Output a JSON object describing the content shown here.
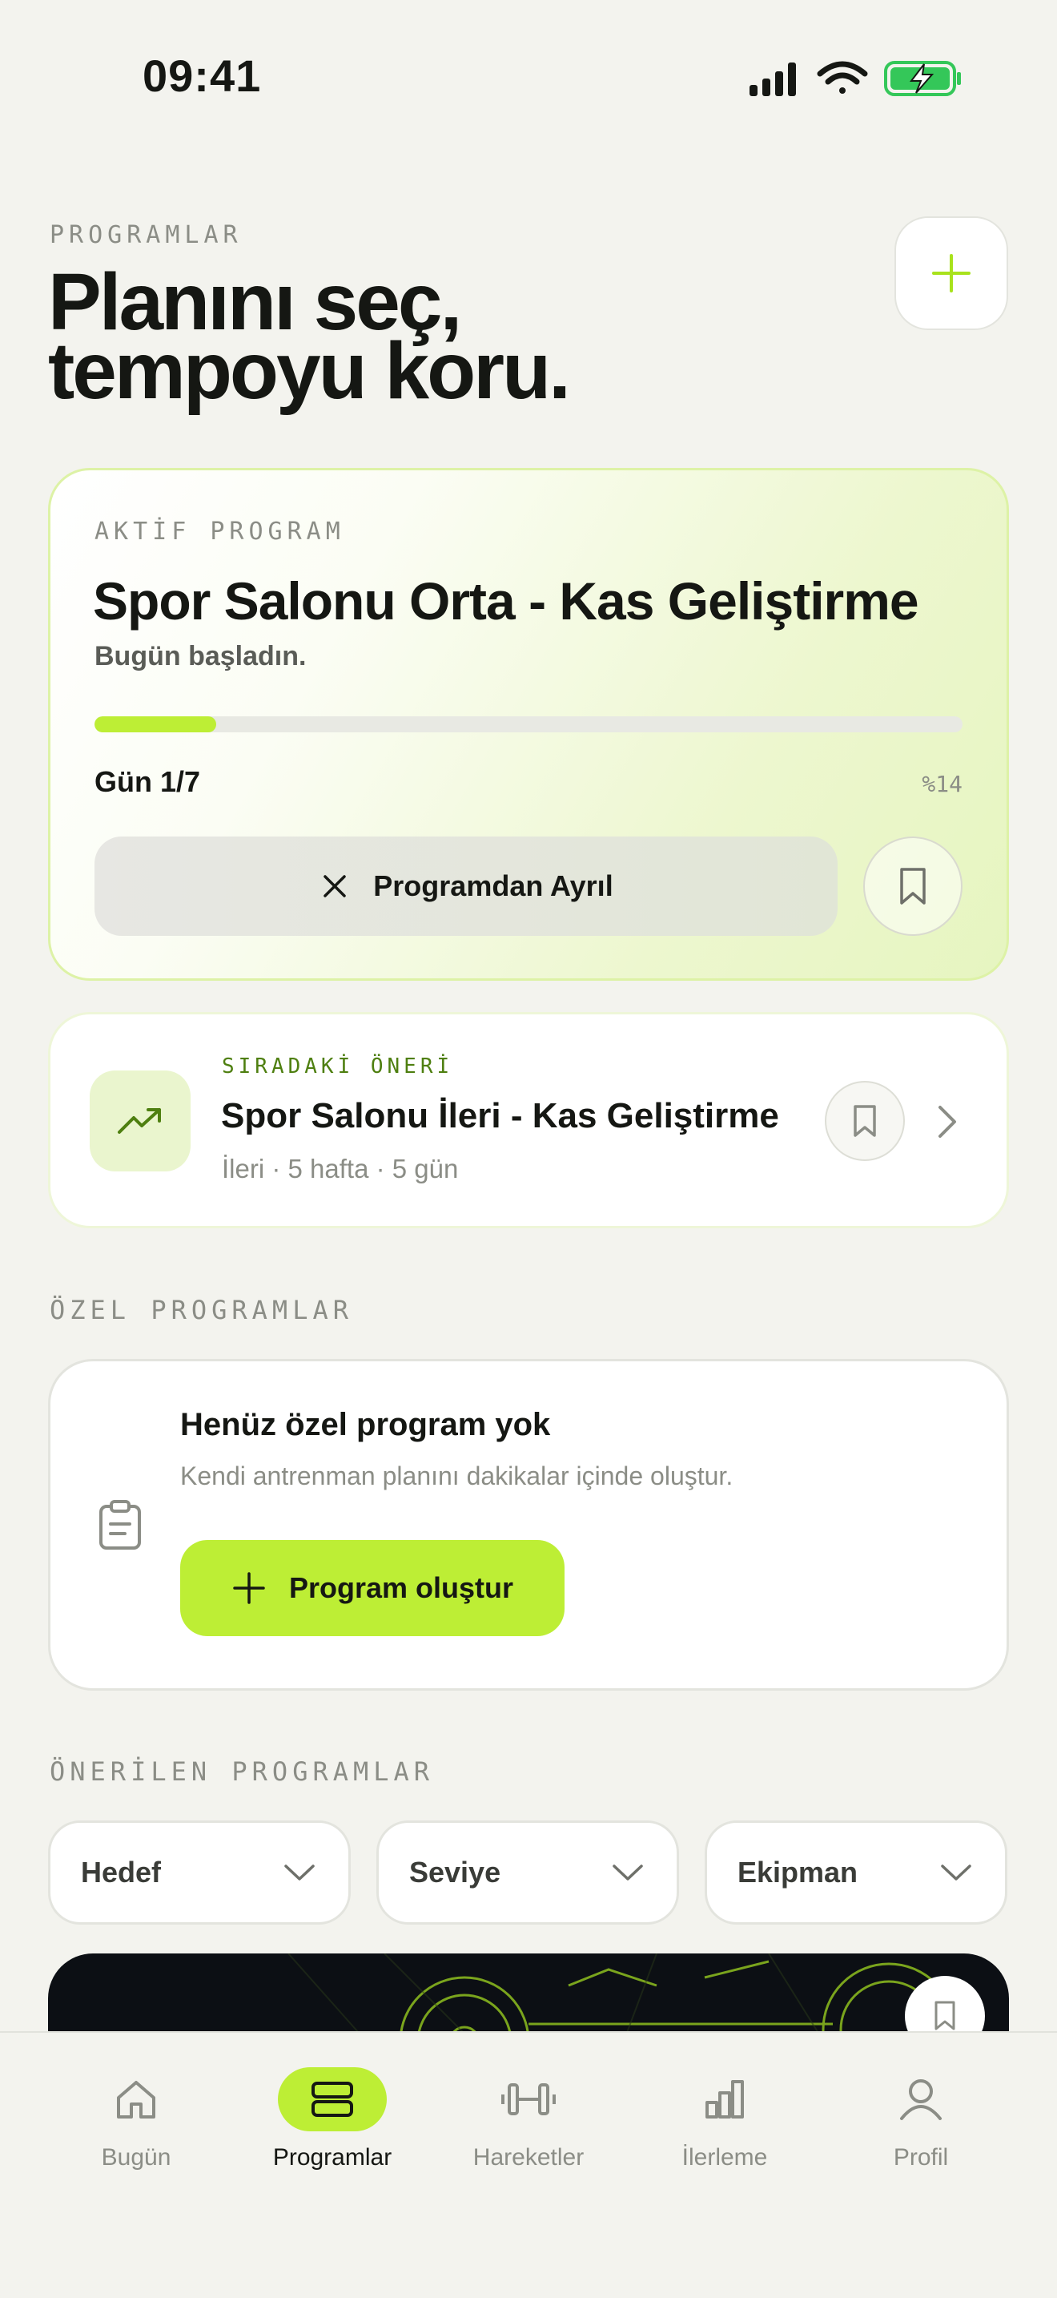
{
  "status_bar": {
    "time": "09:41"
  },
  "header": {
    "eyebrow": "PROGRAMLAR",
    "title_line1": "Planını seç,",
    "title_line2": "tempoyu koru.",
    "add_icon": "plus-icon"
  },
  "active_program": {
    "eyebrow": "AKTİF PROGRAM",
    "title": "Spor Salonu Orta - Kas Geliştirme",
    "subtitle": "Bugün başladın.",
    "progress_fraction": 0.14,
    "day_label": "Gün 1/7",
    "percent_label": "%14",
    "leave_label": "Programdan Ayrıl",
    "leave_icon": "close-icon",
    "save_icon": "bookmark-icon"
  },
  "next_suggestion": {
    "eyebrow": "SIRADAKİ ÖNERİ",
    "title": "Spor Salonu İleri - Kas Geliştirme",
    "meta": "İleri · 5 hafta · 5 gün",
    "icon": "trending-up-icon"
  },
  "custom_programs": {
    "section_label": "ÖZEL PROGRAMLAR",
    "empty_title": "Henüz özel program yok",
    "empty_subtitle": "Kendi antrenman planını dakikalar içinde oluştur.",
    "create_label": "Program oluştur",
    "icon": "clipboard-icon"
  },
  "recommended": {
    "section_label": "ÖNERİLEN PROGRAMLAR",
    "filters": [
      "Hedef",
      "Seviye",
      "Ekipman"
    ]
  },
  "tabbar": {
    "tabs": [
      {
        "label": "Bugün",
        "icon": "home-icon",
        "active": false
      },
      {
        "label": "Programlar",
        "icon": "programs-icon",
        "active": true
      },
      {
        "label": "Hareketler",
        "icon": "dumbbell-icon",
        "active": false
      },
      {
        "label": "İlerleme",
        "icon": "bar-chart-icon",
        "active": false
      },
      {
        "label": "Profil",
        "icon": "user-icon",
        "active": false
      }
    ]
  },
  "colors": {
    "accent": "#BDEE35",
    "background": "#F3F3EE",
    "text": "#151713",
    "muted": "#8B8D86",
    "success_battery": "#34C759"
  }
}
